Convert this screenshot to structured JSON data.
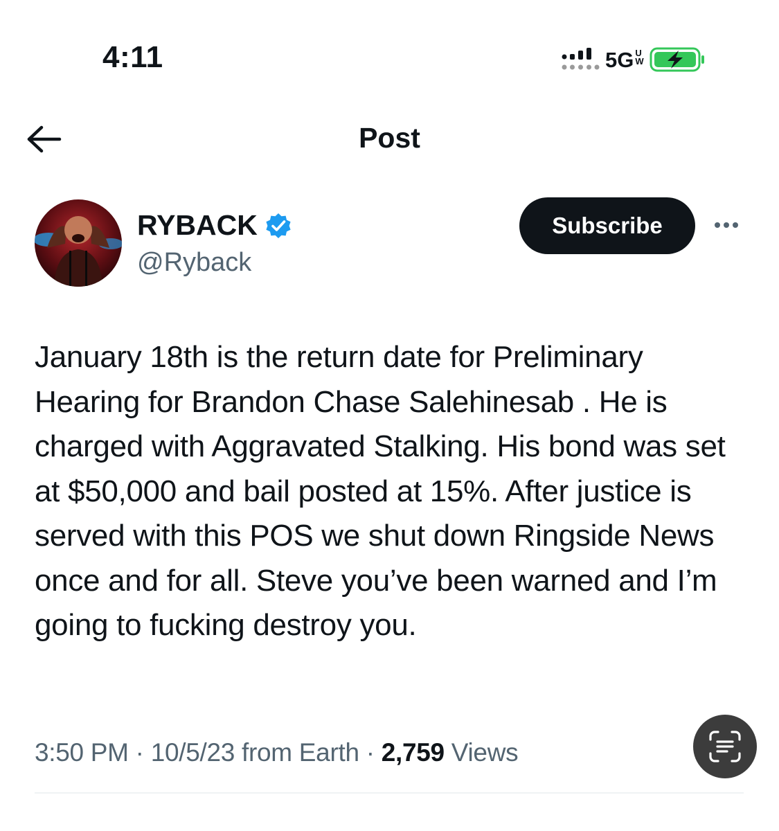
{
  "status_bar": {
    "time": "4:11",
    "network": "5G",
    "network_sub": [
      "U",
      "W"
    ],
    "battery_state": "charging",
    "icons": [
      "signal-icon",
      "battery-charging-icon"
    ]
  },
  "nav": {
    "title": "Post",
    "back_icon": "arrow-left-icon"
  },
  "author": {
    "name": "RYBACK",
    "handle": "@Ryback",
    "verified_icon": "verified-badge-icon",
    "verified_color": "#1d9bf0"
  },
  "actions": {
    "subscribe_label": "Subscribe",
    "more_icon": "more-horizontal-icon"
  },
  "post": {
    "text": "January 18th is the return date for Preliminary Hearing for Brandon Chase Salehinesab . He is charged with Aggravated Stalking. His bond was set at $50,000 and bail posted at 15%. After justice is served with this POS we shut down Ringside News once and for all. Steve you’ve been warned and I’m going to fucking destroy you."
  },
  "meta": {
    "time": "3:50 PM",
    "separator": " · ",
    "date_source": "10/5/23 from Earth",
    "views_count": "2,759",
    "views_label": "Views"
  },
  "overlay": {
    "scan_icon": "live-text-scan-icon"
  },
  "colors": {
    "text": "#0f1419",
    "secondary": "#536471",
    "button_bg": "#0f1419",
    "battery_green": "#34c759"
  }
}
